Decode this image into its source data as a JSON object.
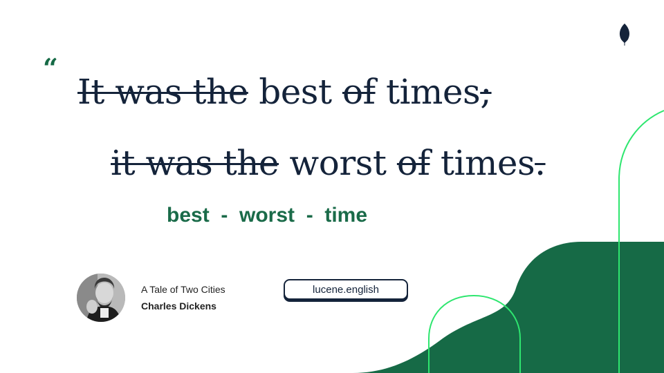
{
  "quote": {
    "mark": "“",
    "line1": [
      {
        "text": "It was the",
        "struck": true
      },
      {
        "text": " best ",
        "struck": false
      },
      {
        "text": "of",
        "struck": true
      },
      {
        "text": " times",
        "struck": false
      },
      {
        "text": ";",
        "struck": true
      }
    ],
    "line2": [
      {
        "text": "it was the",
        "struck": true
      },
      {
        "text": " worst ",
        "struck": false
      },
      {
        "text": "of",
        "struck": true
      },
      {
        "text": " times",
        "struck": false
      },
      {
        "text": ".",
        "struck": true
      }
    ]
  },
  "keywords": "best  -  worst  -  time",
  "source": {
    "book_title": "A Tale of Two Cities",
    "author": "Charles Dickens"
  },
  "brand_handle": "lucene.english",
  "colors": {
    "accent_green": "#166a46",
    "bright_green_line": "#2ee66f",
    "text_dark": "#14233a"
  },
  "icons": {
    "brand": "leaf-icon",
    "author": "author-portrait"
  }
}
